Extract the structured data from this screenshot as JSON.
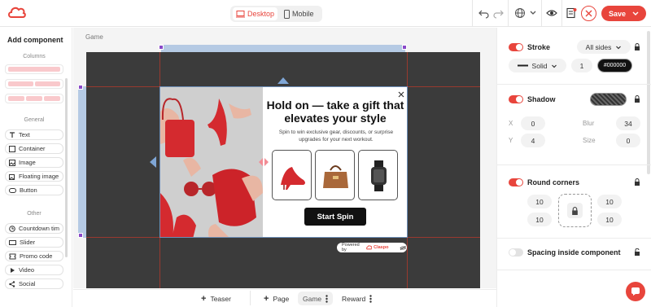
{
  "toolbar": {
    "device_desktop": "Desktop",
    "device_mobile": "Mobile",
    "save_label": "Save"
  },
  "left_panel": {
    "title": "Add component",
    "section_columns": "Columns",
    "section_general": "General",
    "section_other": "Other",
    "general_items": [
      "Text",
      "Container",
      "Image",
      "Floating image",
      "Button"
    ],
    "other_items": [
      "Countdown tim",
      "Slider",
      "Promo code",
      "Video",
      "Social"
    ]
  },
  "canvas": {
    "step_label": "Game",
    "popup": {
      "title": "Hold on — take a gift that elevates your style",
      "subtitle": "Spin to win exclusive gear, discounts, or surprise upgrades for your next workout.",
      "cta": "Start Spin",
      "powered_by": "Powered by",
      "brand": "Claspo"
    }
  },
  "bottom_bar": {
    "teaser": "Teaser",
    "page": "Page",
    "game": "Game",
    "reward": "Reward"
  },
  "right_panel": {
    "stroke": {
      "label": "Stroke",
      "sides": "All sides",
      "style": "Solid",
      "width": "1",
      "color": "#000000"
    },
    "shadow": {
      "label": "Shadow",
      "x_label": "X",
      "x": "0",
      "y_label": "Y",
      "y": "4",
      "blur_label": "Blur",
      "blur": "34",
      "size_label": "Size",
      "size": "0"
    },
    "round_corners": {
      "label": "Round corners",
      "tl": "10",
      "tr": "10",
      "bl": "10",
      "br": "10"
    },
    "spacing": {
      "label": "Spacing inside component"
    }
  },
  "colors": {
    "accent": "#e8453c",
    "canvas_bg": "#3b3b3b"
  }
}
